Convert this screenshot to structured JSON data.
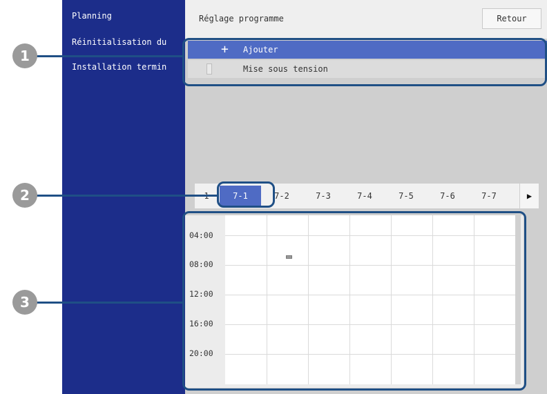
{
  "sidebar": {
    "items": [
      {
        "label": "Planning"
      },
      {
        "label": "Réinitialisation du"
      },
      {
        "label": "Installation termin"
      }
    ]
  },
  "header": {
    "title": "Réglage programme",
    "back_label": "Retour"
  },
  "schedule_list": {
    "add_label": "Ajouter",
    "event_label": "Mise sous tension"
  },
  "tabs": {
    "first_partial": "1",
    "items": [
      "7-1",
      "7-2",
      "7-3",
      "7-4",
      "7-5",
      "7-6",
      "7-7"
    ],
    "next_arrow": "▶",
    "active": "7-1"
  },
  "timetable": {
    "time_labels": [
      "04:00",
      "08:00",
      "12:00",
      "16:00",
      "20:00"
    ]
  },
  "callouts": [
    "1",
    "2",
    "3"
  ],
  "colors": {
    "sidebar": "#1c2d8a",
    "selected": "#4f6bc4",
    "callout": "#1f4f85"
  }
}
